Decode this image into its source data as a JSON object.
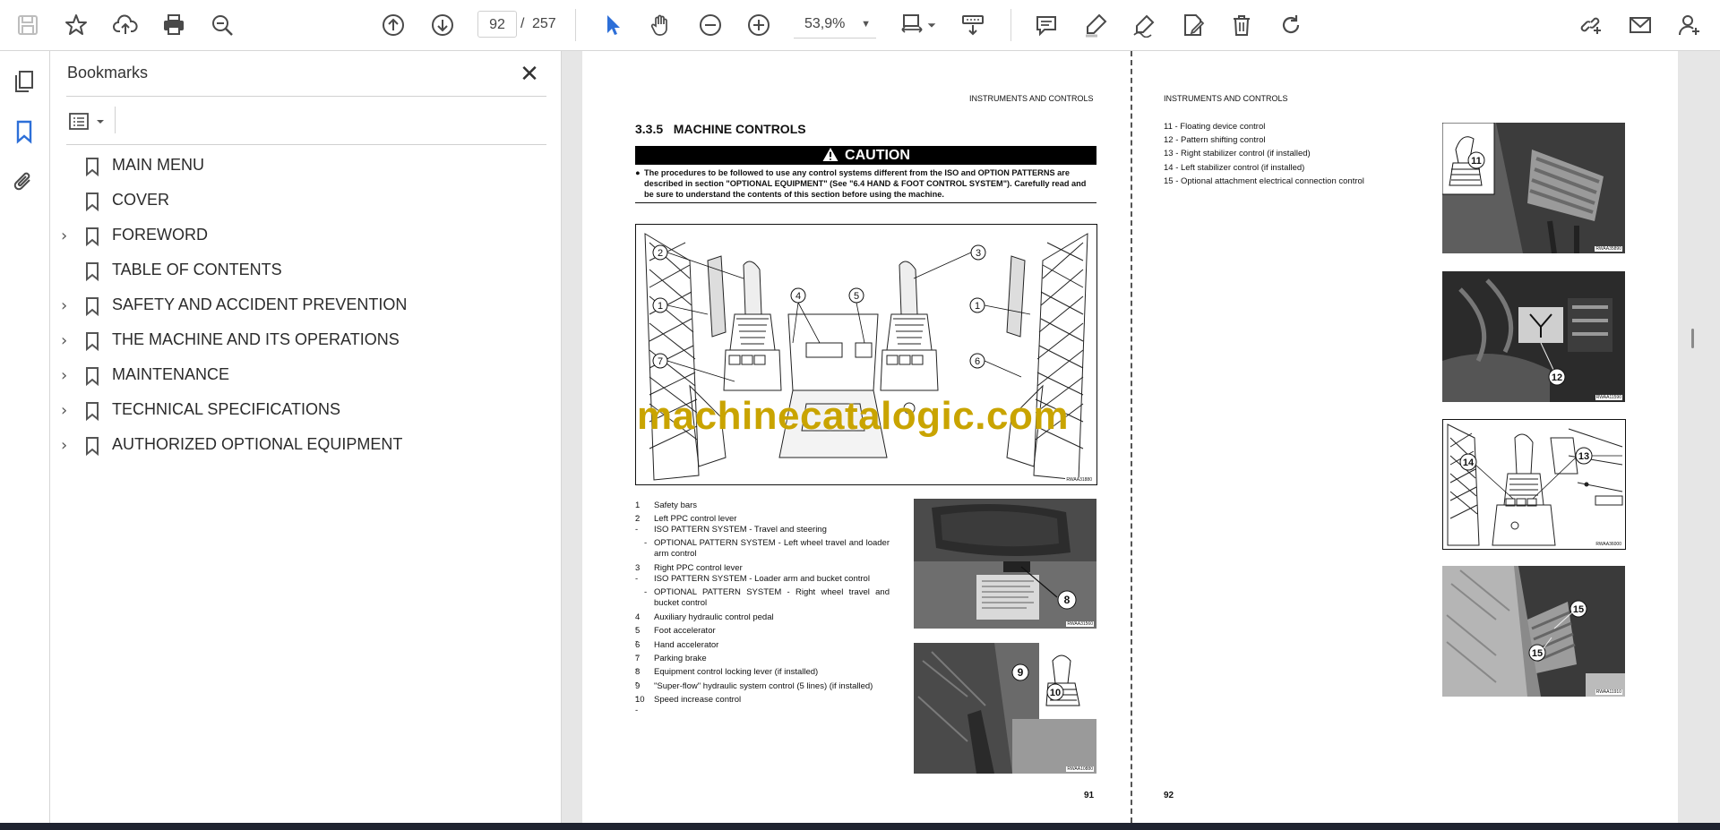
{
  "toolbar": {
    "page_current": "92",
    "page_separator": "/",
    "page_total": "257",
    "zoom": "53,9%"
  },
  "bookmarks_panel": {
    "title": "Bookmarks",
    "items": [
      {
        "label": "MAIN MENU",
        "expandable": false
      },
      {
        "label": "COVER",
        "expandable": false
      },
      {
        "label": "FOREWORD",
        "expandable": true
      },
      {
        "label": "TABLE OF CONTENTS",
        "expandable": false
      },
      {
        "label": "SAFETY AND ACCIDENT PREVENTION",
        "expandable": true
      },
      {
        "label": "THE MACHINE AND ITS OPERATIONS",
        "expandable": true
      },
      {
        "label": "MAINTENANCE",
        "expandable": true
      },
      {
        "label": "TECHNICAL SPECIFICATIONS",
        "expandable": true
      },
      {
        "label": "AUTHORIZED OPTIONAL EQUIPMENT",
        "expandable": true
      }
    ]
  },
  "left_page": {
    "header": "INSTRUMENTS AND CONTROLS",
    "section": "3.3.5   MACHINE CONTROLS",
    "caution_title": "CAUTION",
    "caution_text": "The procedures to be followed to use any control systems different from the ISO and OPTION PATTERNS are described in section \"OPTIONAL EQUIPMENT\" (See \"6.4 HAND & FOOT CONTROL SYSTEM\"). Carefully read and be sure to understand the contents of this section before using the machine.",
    "figure_code": "RWAA31880",
    "watermark": "machinecatalogic.com",
    "callouts": [
      "2",
      "1",
      "7",
      "4",
      "5",
      "3",
      "1",
      "6"
    ],
    "list": [
      {
        "num": "1 -",
        "text": "Safety bars"
      },
      {
        "num": "2 -",
        "text": "Left PPC control lever"
      },
      {
        "num": "",
        "text": "ISO PATTERN SYSTEM - Travel and steering"
      },
      {
        "num": "-",
        "text": "OPTIONAL PATTERN SYSTEM - Left wheel travel and loader arm control"
      },
      {
        "num": "3 -",
        "text": "Right PPC control lever"
      },
      {
        "num": "",
        "text": "ISO PATTERN SYSTEM - Loader arm and bucket control"
      },
      {
        "num": "-",
        "text": "OPTIONAL PATTERN SYSTEM - Right wheel travel and bucket control"
      },
      {
        "num": "4 -",
        "text": "Auxiliary hydraulic control pedal"
      },
      {
        "num": "5 -",
        "text": "Foot accelerator"
      },
      {
        "num": "6 -",
        "text": "Hand accelerator"
      },
      {
        "num": "7 -",
        "text": "Parking brake"
      },
      {
        "num": "8 -",
        "text": "Equipment control locking lever (if installed)"
      },
      {
        "num": "9 -",
        "text": "\"Super-flow\" hydraulic system control (5 lines) (if installed)"
      },
      {
        "num": "10 -",
        "text": "Speed increase control"
      }
    ],
    "photo1_code": "RWAA31560",
    "photo1_callout": "8",
    "photo2_code": "RWAA10880",
    "photo2_callouts": [
      "9",
      "10"
    ],
    "page_number": "91"
  },
  "right_page": {
    "header": "INSTRUMENTS AND CONTROLS",
    "list": [
      "11 - Floating device control",
      "12 - Pattern shifting control",
      "13 - Right stabilizer control (if installed)",
      "14 - Left stabilizer control (if installed)",
      "15 - Optional attachment electrical connection control"
    ],
    "photo_codes": [
      "RWAA35890",
      "RWAA11590",
      "RWAA36000",
      "RWAA11910"
    ],
    "callouts": [
      "11",
      "12",
      "14",
      "13",
      "15",
      "15"
    ],
    "page_number": "92"
  },
  "colors": {
    "toolbar_icon": "#4a4a4a",
    "active_tool": "#2d6fd8",
    "watermark": "#c9a400"
  }
}
